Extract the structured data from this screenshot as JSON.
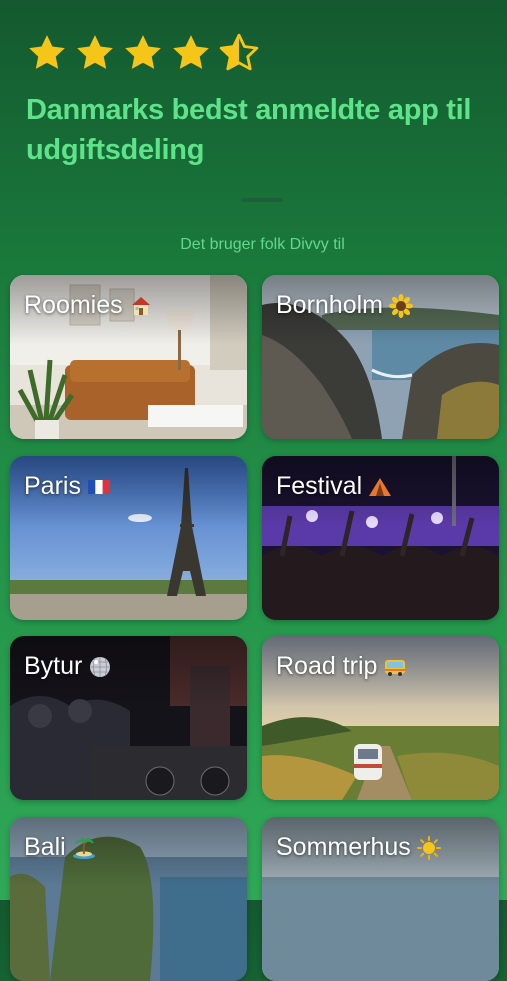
{
  "rating": {
    "stars": 4.5,
    "star_color": "#f5c518"
  },
  "headline": "Danmarks bedst anmeldte app til udgiftsdeling",
  "subtitle": "Det bruger folk Divvy til",
  "colors": {
    "headline": "#5fe38a",
    "background_top": "#14592f",
    "background_bottom": "#2fa957"
  },
  "categories": [
    {
      "label": "Roomies",
      "icon": "house-icon"
    },
    {
      "label": "Bornholm",
      "icon": "sunflower-icon"
    },
    {
      "label": "Paris",
      "icon": "france-flag-icon"
    },
    {
      "label": "Festival",
      "icon": "tent-icon"
    },
    {
      "label": "Bytur",
      "icon": "disco-ball-icon"
    },
    {
      "label": "Road trip",
      "icon": "bus-icon"
    },
    {
      "label": "Bali",
      "icon": "island-icon"
    },
    {
      "label": "Sommerhus",
      "icon": "sun-icon"
    }
  ]
}
